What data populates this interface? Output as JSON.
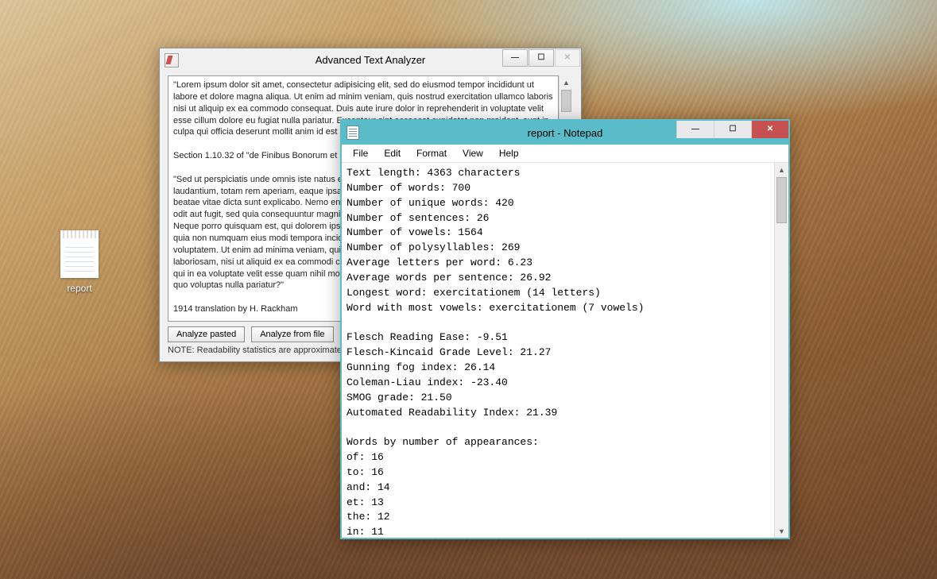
{
  "desktop": {
    "file_label": "report"
  },
  "analyzer": {
    "title": "Advanced Text Analyzer",
    "text": "\"Lorem ipsum dolor sit amet, consectetur adipisicing elit, sed do eiusmod tempor incididunt ut labore et dolore magna aliqua. Ut enim ad minim veniam, quis nostrud exercitation ullamco laboris nisi ut aliquip ex ea commodo consequat. Duis aute irure dolor in reprehenderit in voluptate velit esse cillum dolore eu fugiat nulla pariatur. Excepteur sint occaecat cupidatat non proident, sunt in culpa qui officia deserunt mollit anim id est laborum.\"\n\nSection 1.10.32 of \"de Finibus Bonorum et Malorum\", written by Cicero in 45 BC\n\n\"Sed ut perspiciatis unde omnis iste natus error sit voluptatem accusantium doloremque laudantium, totam rem aperiam, eaque ipsa quae ab illo inventore veritatis et quasi architecto beatae vitae dicta sunt explicabo. Nemo enim ipsam voluptatem quia voluptas sit aspernatur aut odit aut fugit, sed quia consequuntur magni dolores eos qui ratione voluptatem sequi nesciunt. Neque porro quisquam est, qui dolorem ipsum quia dolor sit amet, consectetur, adipisci velit, sed quia non numquam eius modi tempora incidunt ut labore et dolore magnam aliquam quaerat voluptatem. Ut enim ad minima veniam, quis nostrum exercitationem ullam corporis suscipit laboriosam, nisi ut aliquid ex ea commodi consequatur? Quis autem vel eum iure reprehenderit qui in ea voluptate velit esse quam nihil molestiae consequatur, vel illum qui dolorem eum fugiat quo voluptas nulla pariatur?\"\n\n1914 translation by H. Rackham\n\n\"But I must explain to you how all this mistaken idea of denouncing pleasure and praising",
    "btn_paste": "Analyze pasted",
    "btn_file": "Analyze from file",
    "note": "NOTE: Readability statistics are approximate"
  },
  "notepad": {
    "title": "report - Notepad",
    "menu": {
      "file": "File",
      "edit": "Edit",
      "format": "Format",
      "view": "View",
      "help": "Help"
    },
    "content": "Text length: 4363 characters\nNumber of words: 700\nNumber of unique words: 420\nNumber of sentences: 26\nNumber of vowels: 1564\nNumber of polysyllables: 269\nAverage letters per word: 6.23\nAverage words per sentence: 26.92\nLongest word: exercitationem (14 letters)\nWord with most vowels: exercitationem (7 vowels)\n\nFlesch Reading Ease: -9.51\nFlesch-Kincaid Grade Level: 21.27\nGunning fog index: 26.14\nColeman-Liau index: -23.40\nSMOG grade: 21.50\nAutomated Readability Index: 21.39\n\nWords by number of appearances:\nof: 16\nto: 16\nand: 14\net: 13\nthe: 12\nin: 11"
  }
}
